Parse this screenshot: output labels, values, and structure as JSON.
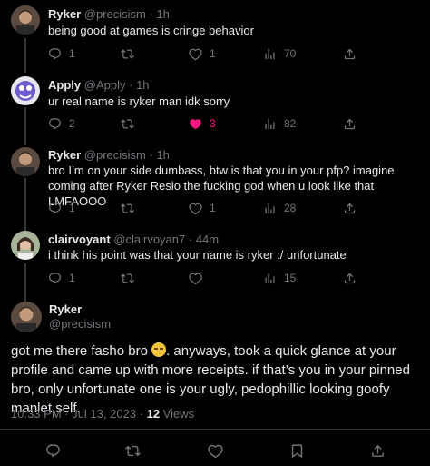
{
  "colors": {
    "background": "#000000",
    "text": "#e7e9ea",
    "muted": "#71767b",
    "like_active": "#f91880",
    "divider": "#2f3336"
  },
  "tweets": [
    {
      "name": "Ryker",
      "handle": "@precisism",
      "time": "1h",
      "text": "being good at games is cringe behavior",
      "replies": "1",
      "retweets": "",
      "likes": "1",
      "views": "70",
      "liked": false
    },
    {
      "name": "Apply",
      "handle": "@Apply",
      "time": "1h",
      "text": "ur real name is ryker man idk sorry",
      "replies": "2",
      "retweets": "",
      "likes": "3",
      "views": "82",
      "liked": true
    },
    {
      "name": "Ryker",
      "handle": "@precisism",
      "time": "1h",
      "text": "bro I’m on your side dumbass, btw is that you in your pfp? imagine coming after Ryker Resio the fucking god when u look like that LMFAOOO",
      "replies": "1",
      "retweets": "",
      "likes": "1",
      "views": "28",
      "liked": false
    },
    {
      "name": "clairvoyant",
      "handle": "@clairvoyan7",
      "time": "44m",
      "text": "i think his point was that your name is ryker :/ unfortunate",
      "replies": "1",
      "retweets": "",
      "likes": "",
      "views": "15",
      "liked": false
    }
  ],
  "main_tweet": {
    "name": "Ryker",
    "handle": "@precisism",
    "text_before_emoji": "got me there fasho bro ",
    "text_after_emoji": ". anyways, took a quick glance at your profile and came up with more receipts. if that’s you in your pinned bro, only unfortunate one is your ugly, pedophillic looking goofy manlet self.",
    "timestamp": "10:33 PM · Jul 13, 2023 · ",
    "views_count": "12",
    "views_label": " Views"
  },
  "icons": [
    "reply-icon",
    "retweet-icon",
    "like-icon",
    "views-icon",
    "share-icon",
    "bookmark-icon"
  ]
}
